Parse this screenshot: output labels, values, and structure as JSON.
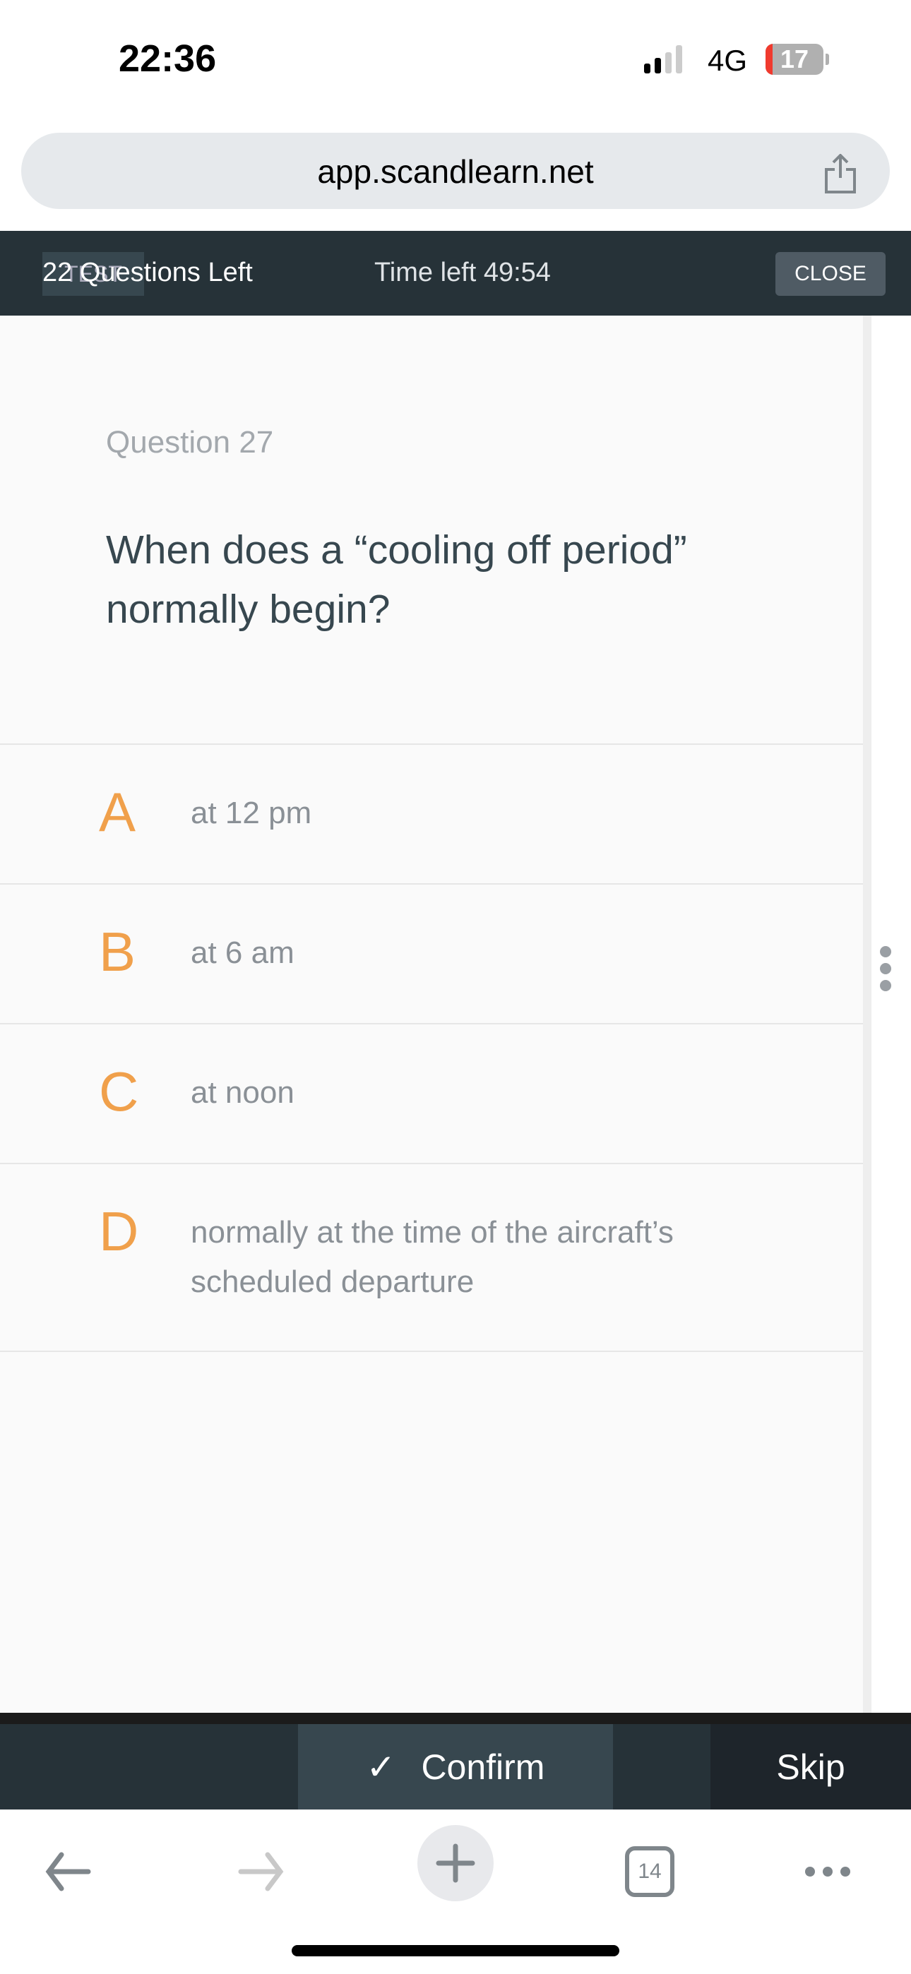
{
  "status_bar": {
    "time": "22:36",
    "network": "4G",
    "battery": "17"
  },
  "browser": {
    "url": "app.scandlearn.net",
    "tabs_count": "14"
  },
  "header": {
    "tag": "TEST",
    "questions_left": "22 Questions Left",
    "time_left": "Time left  49:54",
    "close_label": "CLOSE"
  },
  "question": {
    "number_label": "Question 27",
    "text": "When does a “cooling off period” normally begin?"
  },
  "options": [
    {
      "letter": "A",
      "text": "at 12 pm"
    },
    {
      "letter": "B",
      "text": "at 6 am"
    },
    {
      "letter": "C",
      "text": "at noon"
    },
    {
      "letter": "D",
      "text": "normally at the time of the aircraft’s scheduled departure"
    }
  ],
  "footer": {
    "confirm_icon": "✓",
    "confirm_label": "Confirm",
    "skip_label": "Skip"
  },
  "colors": {
    "header": "#263238",
    "accent": "#f0a04b",
    "confirm": "#37474f"
  }
}
